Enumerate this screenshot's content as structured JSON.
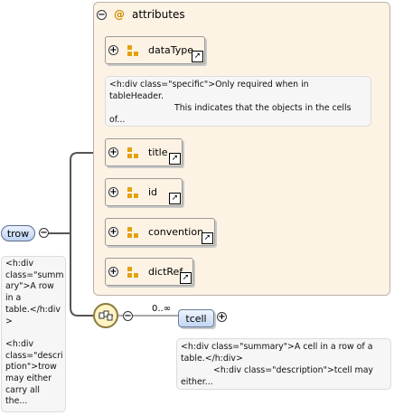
{
  "root": {
    "name": "trow",
    "doc": [
      "<h:div",
      "class=\"summ",
      "ary\">A row",
      "in a",
      "table.</h:div",
      ">",
      "",
      "<h:div",
      "class=\"descri",
      "ption\">trow",
      "may either",
      "carry all",
      "the..."
    ]
  },
  "attributes": {
    "title": "attributes",
    "at_symbol": "@",
    "items": [
      {
        "label": "dataType"
      },
      {
        "label": "title"
      },
      {
        "label": "id"
      },
      {
        "label": "convention"
      },
      {
        "label": "dictRef"
      }
    ],
    "datatype_doc": [
      "<h:div class=\"specific\">Only required when in",
      "tableHeader.",
      "This indicates that the objects in the cells",
      "of..."
    ]
  },
  "sequence": {
    "occurrence": "0..∞"
  },
  "child": {
    "name": "tcell",
    "doc": [
      "<h:div class=\"summary\">A cell in a row of a",
      "table.</h:div>",
      "<h:div class=\"description\">tcell may",
      "either..."
    ]
  },
  "icons": {
    "collapse": "minus-circle-icon",
    "expand": "plus-circle-icon",
    "attribute": "attribute-icon",
    "link": "link-arrow-icon",
    "sequence": "sequence-icon"
  },
  "colors": {
    "panel_bg": "#fdf3e4",
    "element_blue": "#bcd2f3",
    "attribute_orange": "#e2a20c",
    "sequence_yellow": "#fff3c4"
  }
}
